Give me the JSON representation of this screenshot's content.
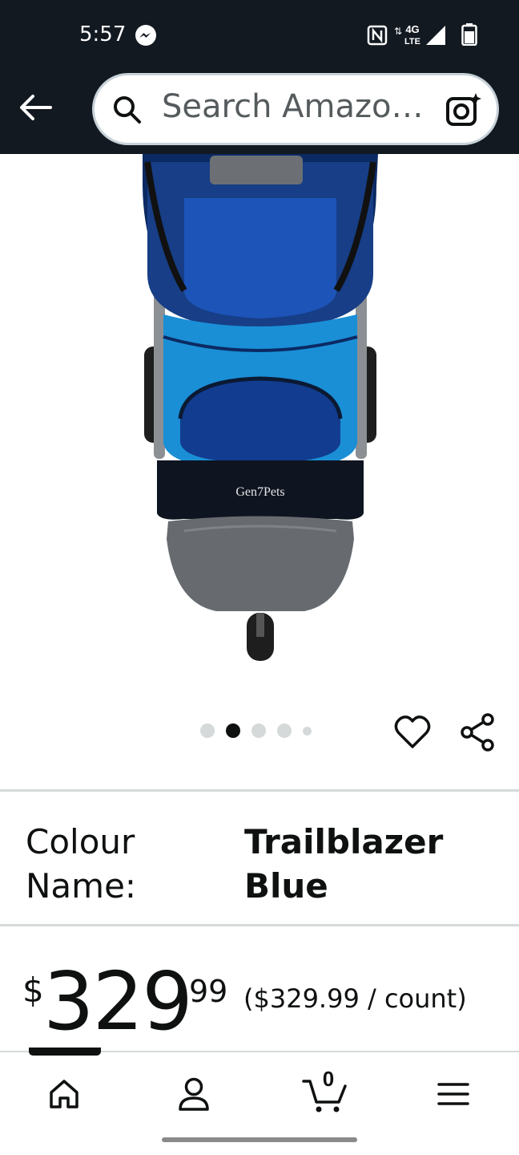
{
  "status_bar": {
    "time": "5:57",
    "network": "4G",
    "network_sub": "LTE",
    "messenger_icon": "messenger-icon",
    "nfc_icon": "nfc-icon",
    "signal_icon": "signal-icon",
    "battery_icon": "battery-icon"
  },
  "header": {
    "back_icon": "back-arrow-icon",
    "search_placeholder": "Search Amazo…",
    "search_icon": "search-icon",
    "camera_icon": "camera-lens-icon"
  },
  "product": {
    "image_alt": "pet-stroller-image",
    "brand_logo_text": "Gen7Pets",
    "carousel": {
      "total_dots": 5,
      "active_index": 1
    },
    "colour_label": "Colour Name:",
    "colour_value": "Trailblazer Blue",
    "price": {
      "symbol": "$",
      "whole": "329",
      "fraction": "99",
      "unit_price": "($329.99 / count)"
    }
  },
  "bottom_nav": {
    "items": [
      {
        "name": "home",
        "icon": "home-icon"
      },
      {
        "name": "account",
        "icon": "person-icon"
      },
      {
        "name": "cart",
        "icon": "cart-icon",
        "count": "0"
      },
      {
        "name": "menu",
        "icon": "hamburger-menu-icon"
      }
    ],
    "active": "home"
  },
  "colors": {
    "header_bg": "#131921",
    "text": "#0f1111",
    "divider": "#d5d9d9",
    "stroller_blue": "#1a8fd6"
  }
}
